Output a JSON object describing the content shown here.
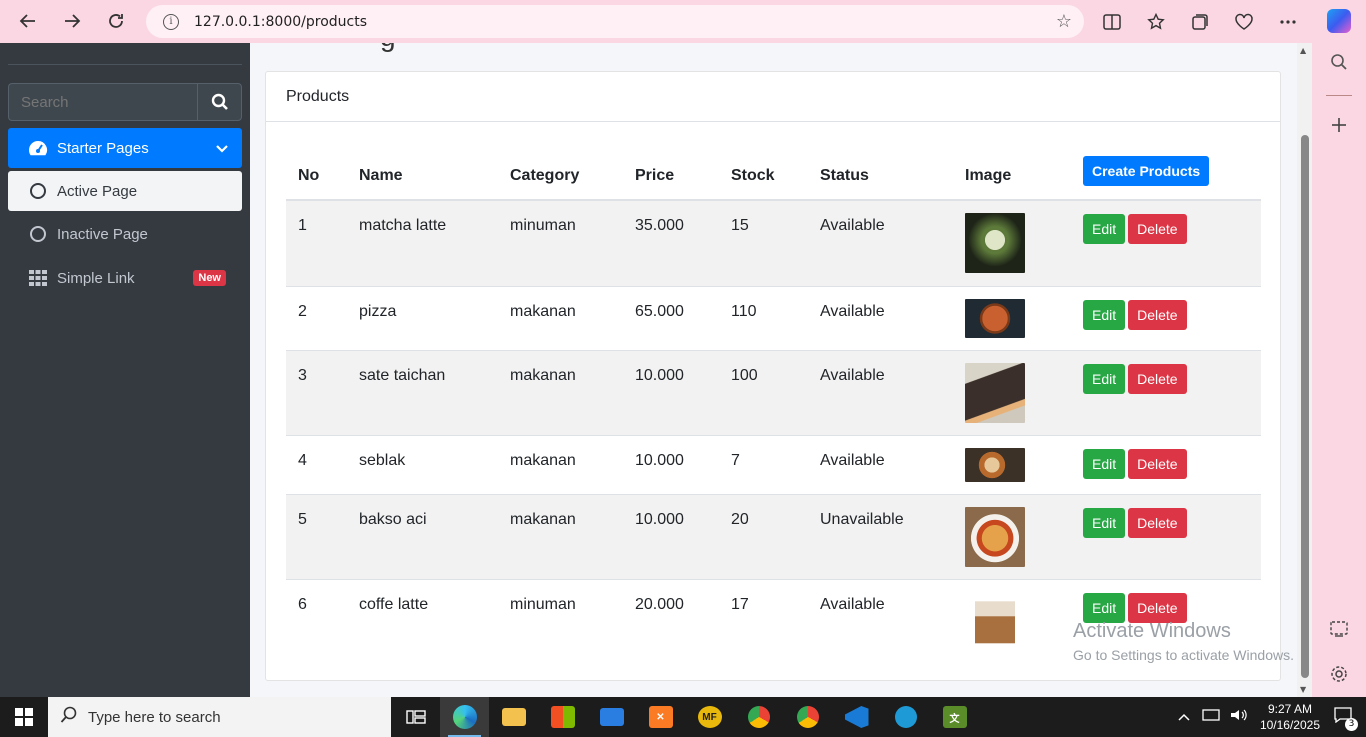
{
  "browser": {
    "url": "127.0.0.1:8000/products",
    "info_glyph": "i"
  },
  "page": {
    "title_peek": "g"
  },
  "sidebar": {
    "search_placeholder": "Search",
    "items": [
      {
        "label": "Starter Pages"
      },
      {
        "label": "Active Page"
      },
      {
        "label": "Inactive Page"
      },
      {
        "label": "Simple Link",
        "badge": "New"
      }
    ]
  },
  "card": {
    "title": "Products",
    "create_label": "Create Products",
    "columns": [
      "No",
      "Name",
      "Category",
      "Price",
      "Stock",
      "Status",
      "Image"
    ],
    "rows": [
      {
        "no": "1",
        "name": "matcha latte",
        "category": "minuman",
        "price": "35.000",
        "stock": "15",
        "status": "Available",
        "edit": "Edit",
        "delete": "Delete"
      },
      {
        "no": "2",
        "name": "pizza",
        "category": "makanan",
        "price": "65.000",
        "stock": "110",
        "status": "Available",
        "edit": "Edit",
        "delete": "Delete"
      },
      {
        "no": "3",
        "name": "sate taichan",
        "category": "makanan",
        "price": "10.000",
        "stock": "100",
        "status": "Available",
        "edit": "Edit",
        "delete": "Delete"
      },
      {
        "no": "4",
        "name": "seblak",
        "category": "makanan",
        "price": "10.000",
        "stock": "7",
        "status": "Available",
        "edit": "Edit",
        "delete": "Delete"
      },
      {
        "no": "5",
        "name": "bakso aci",
        "category": "makanan",
        "price": "10.000",
        "stock": "20",
        "status": "Unavailable",
        "edit": "Edit",
        "delete": "Delete"
      },
      {
        "no": "6",
        "name": "coffe latte",
        "category": "minuman",
        "price": "20.000",
        "stock": "17",
        "status": "Available",
        "edit": "Edit",
        "delete": "Delete"
      }
    ]
  },
  "watermark": {
    "line1": "Activate Windows",
    "line2": "Go to Settings to activate Windows."
  },
  "taskbar": {
    "search_placeholder": "Type here to search",
    "time": "9:27 AM",
    "date": "10/16/2025",
    "notification_count": "3",
    "mf_label": "MF"
  },
  "colors": {
    "accent": "#007bff",
    "edit": "#28a745",
    "delete": "#dc3545",
    "sidebar_bg": "#343a40",
    "browser_bar": "#fbd7e4"
  }
}
